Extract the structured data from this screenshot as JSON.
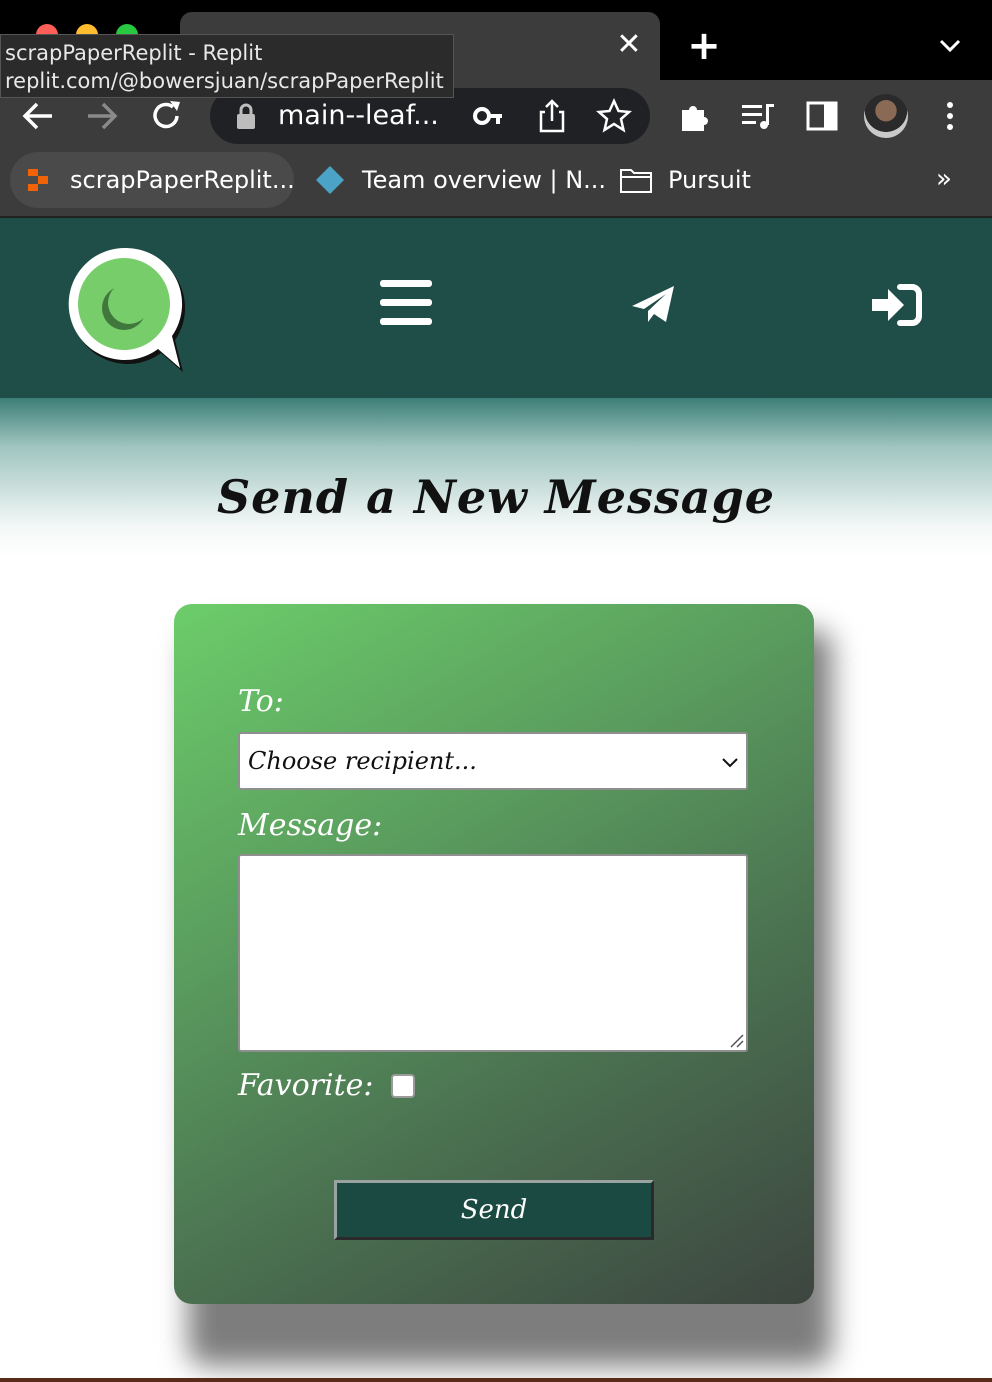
{
  "browser": {
    "tooltip": {
      "title": "scrapPaperReplit - Replit",
      "url": "replit.com/@bowersjuan/scrapPaperReplit"
    },
    "tab_close_icon": "close-icon",
    "new_tab_icon": "plus-icon",
    "address": "main--leaf...",
    "bookmarks": [
      {
        "label": "scrapPaperReplit...",
        "icon": "replit-icon"
      },
      {
        "label": "Team overview | N...",
        "icon": "diamond-icon"
      },
      {
        "label": "Pursuit",
        "icon": "folder-icon"
      }
    ],
    "bookmarks_more": "»",
    "colors": {
      "chrome_dark": "#000000",
      "toolbar": "#3c3c3c",
      "omnibox": "#202124"
    }
  },
  "site": {
    "header": {
      "logo": "chat-bubble-logo",
      "icons": [
        "hamburger-menu-icon",
        "paper-plane-icon",
        "sign-in-icon"
      ],
      "color": "#1f4d48"
    },
    "title": "Send a New Message",
    "form": {
      "to_label": "To:",
      "recipient_placeholder": "Choose recipient...",
      "message_label": "Message:",
      "message_value": "",
      "favorite_label": "Favorite:",
      "favorite_checked": false,
      "send_label": "Send"
    },
    "colors": {
      "card_start": "#6ccd6a",
      "card_end": "#3d4540",
      "button": "#1b4a42"
    }
  }
}
